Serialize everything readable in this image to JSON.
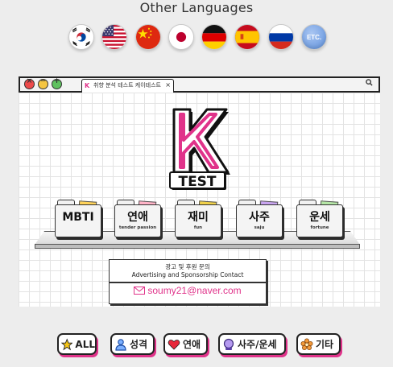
{
  "other_languages": {
    "title": "Other Languages"
  },
  "flags": [
    {
      "name": "korea",
      "icon": "korea-flag-icon"
    },
    {
      "name": "usa",
      "icon": "usa-flag-icon"
    },
    {
      "name": "china",
      "icon": "china-flag-icon"
    },
    {
      "name": "japan",
      "icon": "japan-flag-icon"
    },
    {
      "name": "germany",
      "icon": "germany-flag-icon"
    },
    {
      "name": "spain",
      "icon": "spain-flag-icon"
    },
    {
      "name": "russia",
      "icon": "russia-flag-icon"
    },
    {
      "name": "etc",
      "label": "ETC."
    }
  ],
  "browser": {
    "tab_title": "취향 분석 테스트 케이테스트",
    "tab_close": "×",
    "logo_text": "TEST"
  },
  "folders": [
    {
      "title": "MBTI",
      "subtitle": "",
      "paper_color": "#ffd35a"
    },
    {
      "title": "연애",
      "subtitle": "tender passion",
      "paper_color": "#ffb3c7"
    },
    {
      "title": "재미",
      "subtitle": "fun",
      "paper_color": "#f0d14a"
    },
    {
      "title": "사주",
      "subtitle": "saju",
      "paper_color": "#c9a5f0"
    },
    {
      "title": "운세",
      "subtitle": "fortune",
      "paper_color": "#b5e6a6"
    }
  ],
  "contact": {
    "line1": "광고 및 후원 문의",
    "line2": "Advertising and Sponsorship Contact",
    "email": "soumy21@naver.com"
  },
  "categories": [
    {
      "label": "ALL",
      "icon": "star-icon"
    },
    {
      "label": "성격",
      "icon": "person-icon"
    },
    {
      "label": "연애",
      "icon": "heart-icon"
    },
    {
      "label": "사주/운세",
      "icon": "crystal-ball-icon"
    },
    {
      "label": "기타",
      "icon": "flower-icon"
    }
  ],
  "colors": {
    "accent_pink": "#e0338a",
    "background": "#ededed"
  }
}
